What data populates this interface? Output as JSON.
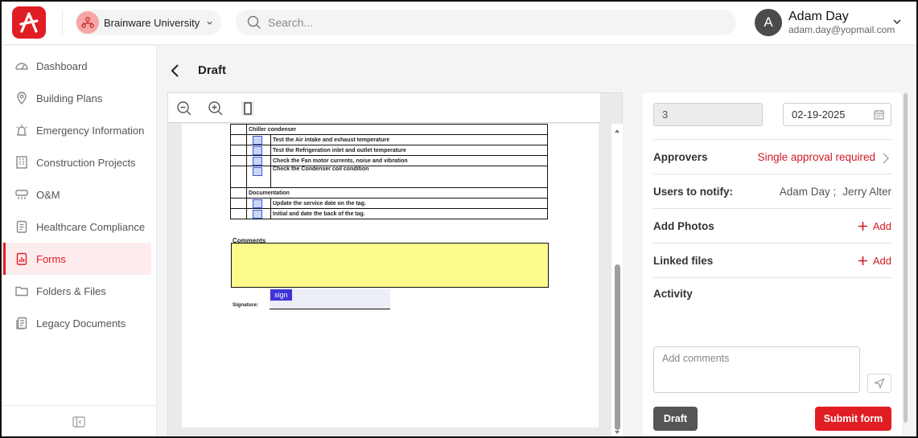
{
  "app": {
    "org_name": "Brainware University",
    "search_placeholder": "Search...",
    "user": {
      "initial": "A",
      "name": "Adam Day",
      "email": "adam.day@yopmail.com"
    },
    "brand_color": "#e11d24"
  },
  "sidebar": {
    "items": [
      {
        "label": "Dashboard",
        "icon": "gauge-icon"
      },
      {
        "label": "Building Plans",
        "icon": "map-pin-icon"
      },
      {
        "label": "Emergency Information",
        "icon": "alarm-light-icon"
      },
      {
        "label": "Construction Projects",
        "icon": "building-icon"
      },
      {
        "label": "O&M",
        "icon": "hvac-icon"
      },
      {
        "label": "Healthcare Compliance",
        "icon": "clipboard-icon"
      },
      {
        "label": "Forms",
        "icon": "form-chart-icon",
        "active": true
      },
      {
        "label": "Folders & Files",
        "icon": "folder-icon"
      },
      {
        "label": "Legacy Documents",
        "icon": "documents-icon"
      }
    ]
  },
  "page": {
    "title": "Draft"
  },
  "document": {
    "rows": [
      {
        "type": "section",
        "text": "Chiller condenser"
      },
      {
        "type": "item",
        "text": "Test the Air intake and exhaust temperature"
      },
      {
        "type": "item",
        "text": "Test the Refrigeration inlet and outlet temperature"
      },
      {
        "type": "item",
        "text": "Check the Fan motor currents, noise and vibration"
      },
      {
        "type": "item-tall",
        "text": "Check the Condenser coil condition"
      },
      {
        "type": "section",
        "text": "Documentation"
      },
      {
        "type": "item",
        "text": "Update the service date on the tag."
      },
      {
        "type": "item",
        "text": "Initial and date the back of the tag."
      }
    ],
    "comments_label": "Comments",
    "signature_label": "Signature:",
    "sign_button": "sign"
  },
  "panel": {
    "number_value": "3",
    "date_value": "02-19-2025",
    "approvers_label": "Approvers",
    "approvers_value": "Single approval required",
    "notify_label": "Users to notify:",
    "notify_users": [
      "Adam Day ;",
      "Jerry Alter"
    ],
    "photos_label": "Add Photos",
    "files_label": "Linked files",
    "add_label": "Add",
    "activity_label": "Activity",
    "comment_placeholder": "Add comments",
    "draft_button": "Draft",
    "submit_button": "Submit form"
  }
}
